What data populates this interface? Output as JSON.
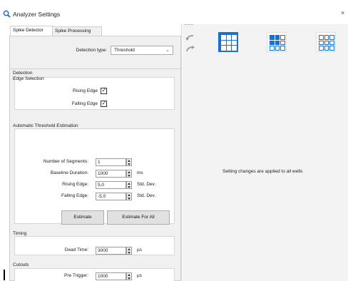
{
  "window": {
    "title": "Analyzer Settings",
    "close_glyph": "×",
    "title_icon": "search-icon"
  },
  "tabs": [
    {
      "label": "Spike Detector",
      "active": true
    },
    {
      "label": "Spike Processing",
      "active": false
    }
  ],
  "detection_type": {
    "label": "Detection type:",
    "value": "Threshold"
  },
  "detection": {
    "section_label": "Detection",
    "edge_selection": {
      "group_label": "Edge Selection",
      "rising_label": "Rising Edge",
      "rising_checked": true,
      "falling_label": "Falling Edge",
      "falling_checked": true
    },
    "auto_threshold": {
      "group_label": "Automatic Threshold Estimation",
      "num_segments_label": "Number of Segments:",
      "num_segments_value": "1",
      "baseline_label": "Baseline Duration:",
      "baseline_value": "1000",
      "baseline_unit": "ms",
      "rising_label": "Rising Edge:",
      "rising_value": "5,0",
      "rising_unit": "Std. Dev.",
      "falling_label": "Falling Edge:",
      "falling_value": "-5,0",
      "falling_unit": "Std. Dev.",
      "estimate_button": "Estimate",
      "estimate_all_button": "Estimate For All"
    }
  },
  "timing": {
    "section_label": "Timing",
    "dead_time_label": "Dead Time:",
    "dead_time_value": "3000",
    "dead_time_unit": "µs"
  },
  "cutouts": {
    "section_label": "Cutouts",
    "pre_trigger_label": "Pre Trigger:",
    "pre_trigger_value": "1000",
    "pre_trigger_unit": "µs"
  },
  "right_panel": {
    "message": "Setting changes are applied to all wells",
    "well_selection_buttons": [
      "all-wells-icon",
      "partial-wells-icon",
      "no-wells-icon"
    ],
    "accent_color": "#1a6fd0"
  }
}
